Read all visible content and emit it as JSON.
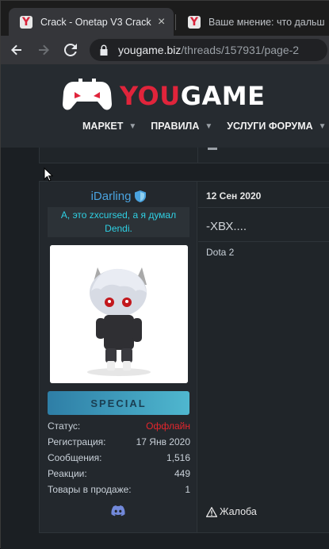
{
  "browser": {
    "tabs": [
      {
        "favicon": "Y",
        "title": "Crack - Onetap V3 Crack |",
        "close": "×"
      },
      {
        "favicon": "Y",
        "title": "Ваше мнение: что дальш",
        "close": ""
      }
    ],
    "url_host": "yougame.biz",
    "url_path": "/threads/157931/page-2"
  },
  "site": {
    "logo_you": "YOU",
    "logo_game": "GAME",
    "nav": [
      "МАРКЕТ",
      "ПРАВИЛА",
      "УСЛУГИ ФОРУМА"
    ]
  },
  "post": {
    "username": "iDarling",
    "user_title": "А, это zxcursed, а я думал Dendi.",
    "banner": "SPECIAL",
    "stats": [
      {
        "label": "Статус:",
        "value": "Оффлайн"
      },
      {
        "label": "Регистрация:",
        "value": "17 Янв 2020"
      },
      {
        "label": "Сообщения:",
        "value": "1,516"
      },
      {
        "label": "Реакции:",
        "value": "449"
      },
      {
        "label": "Товары в продаже:",
        "value": "1"
      }
    ],
    "date": "12 Сен 2020",
    "message": "-ХВХ....",
    "signature": "Dota 2",
    "report": "Жалоба"
  },
  "colors": {
    "brand_red": "#e0243b",
    "username": "#4aa3df",
    "user_title": "#2fd0e3",
    "offline": "#e5262d"
  }
}
